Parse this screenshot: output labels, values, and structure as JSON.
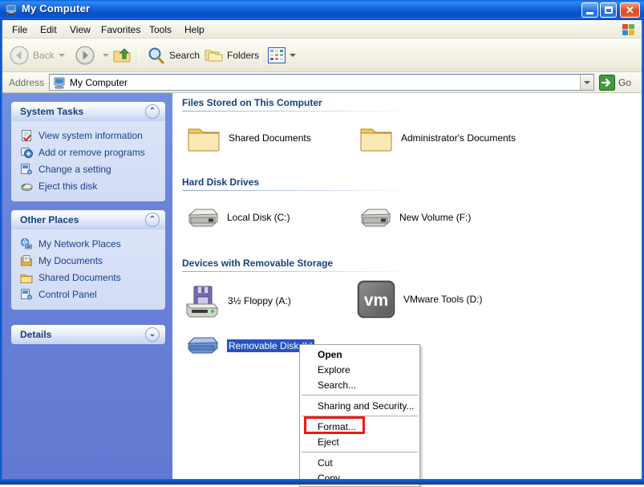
{
  "window": {
    "title": "My Computer",
    "title_icon": "my-computer-icon",
    "buttons": {
      "minimize": "Minimize",
      "maximize": "Maximize",
      "close": "Close"
    }
  },
  "menubar": {
    "items": [
      {
        "label": "File"
      },
      {
        "label": "Edit"
      },
      {
        "label": "View"
      },
      {
        "label": "Favorites"
      },
      {
        "label": "Tools"
      },
      {
        "label": "Help"
      }
    ],
    "brand_icon": "windows-flag-icon"
  },
  "toolbar": {
    "back": "Back",
    "forward": "",
    "up": "",
    "search": "Search",
    "folders": "Folders",
    "views": ""
  },
  "address": {
    "label": "Address",
    "value": "My Computer",
    "icon": "my-computer-icon",
    "go": "Go"
  },
  "sidebar": {
    "panels": [
      {
        "title": "System Tasks",
        "collapse_state": "expanded",
        "items": [
          {
            "label": "View system information",
            "icon": "system-info-icon"
          },
          {
            "label": "Add or remove programs",
            "icon": "add-remove-programs-icon"
          },
          {
            "label": "Change a setting",
            "icon": "control-panel-icon"
          },
          {
            "label": "Eject this disk",
            "icon": "eject-disk-icon"
          }
        ]
      },
      {
        "title": "Other Places",
        "collapse_state": "expanded",
        "items": [
          {
            "label": "My Network Places",
            "icon": "network-places-icon"
          },
          {
            "label": "My Documents",
            "icon": "my-documents-icon"
          },
          {
            "label": "Shared Documents",
            "icon": "shared-folder-icon"
          },
          {
            "label": "Control Panel",
            "icon": "control-panel-icon"
          }
        ]
      },
      {
        "title": "Details",
        "collapse_state": "collapsed",
        "items": []
      }
    ]
  },
  "content": {
    "groups": [
      {
        "heading": "Files Stored on This Computer",
        "items": [
          {
            "label": "Shared Documents",
            "icon": "folder-icon",
            "selected": false
          },
          {
            "label": "Administrator's Documents",
            "icon": "folder-icon",
            "selected": false
          }
        ]
      },
      {
        "heading": "Hard Disk Drives",
        "items": [
          {
            "label": "Local Disk (C:)",
            "icon": "hard-drive-icon",
            "selected": false
          },
          {
            "label": "New Volume (F:)",
            "icon": "hard-drive-icon",
            "selected": false
          }
        ]
      },
      {
        "heading": "Devices with Removable Storage",
        "items": [
          {
            "label": "3½ Floppy (A:)",
            "icon": "floppy-drive-icon",
            "selected": false
          },
          {
            "label": "VMware Tools (D:)",
            "icon": "vmware-cd-icon",
            "selected": false
          },
          {
            "label": "Removable Disk (I:)",
            "icon": "removable-disk-icon",
            "selected": true
          }
        ]
      }
    ]
  },
  "context_menu": {
    "items": [
      {
        "label": "Open",
        "bold": true
      },
      {
        "label": "Explore",
        "bold": false
      },
      {
        "label": "Search...",
        "bold": false
      },
      {
        "separator": true
      },
      {
        "label": "Sharing and Security...",
        "bold": false
      },
      {
        "separator": true
      },
      {
        "label": "Format...",
        "bold": false,
        "highlighted": true
      },
      {
        "label": "Eject",
        "bold": false
      },
      {
        "separator": true
      },
      {
        "label": "Cut",
        "bold": false
      },
      {
        "label": "Copy",
        "bold": false
      }
    ]
  },
  "annotation": {
    "highlight_color": "#ee1b16",
    "target": "Format..."
  },
  "colors": {
    "titlebar_blue": "#1567dd",
    "sidebar_blue": "#6b84d8",
    "panel_header": "#c3d2f2",
    "heading_text": "#15417e",
    "selection_blue": "#2454c4",
    "close_red": "#e04a22"
  }
}
